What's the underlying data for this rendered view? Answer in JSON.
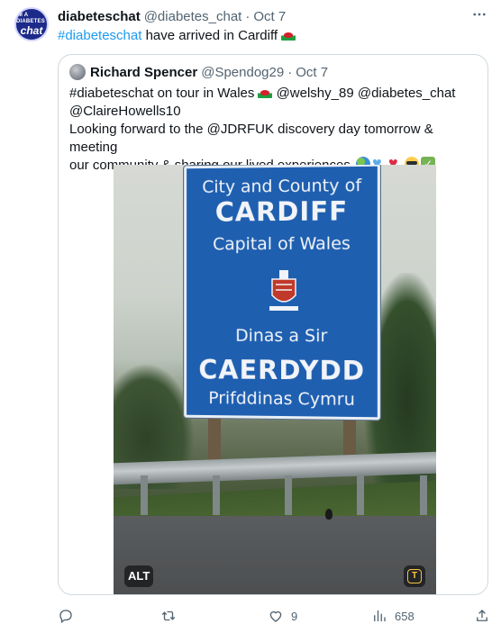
{
  "tweet": {
    "author_name": "diabeteschat",
    "author_handle": "@diabetes_chat",
    "separator": "·",
    "time": "Oct 7",
    "avatar_text_small": "IM A DIABETES",
    "avatar_text_big": "chat",
    "hashtag": "#diabeteschat",
    "text_rest": " have arrived in Cardiff",
    "flag_icon": "wales-flag-icon"
  },
  "quote": {
    "author_name": "Richard Spencer",
    "author_handle": "@Spendog29",
    "separator": "·",
    "time": "Oct 7",
    "line1_a": "#diabeteschat on tour in Wales",
    "line1_b": " @welshy_89 @diabetes_chat",
    "line2": "@ClaireHowells10",
    "line3": "Looking forward to the @JDRFUK discovery day tomorrow & meeting",
    "line4": "our community & sharing our lived experiences",
    "emoji_icons": [
      "globe-icon",
      "blue-heart-icon",
      "red-heart-icon",
      "sunglasses-face-icon",
      "check-mark-icon"
    ]
  },
  "photo": {
    "sign_line1": "City and County of",
    "sign_line2": "CARDIFF",
    "sign_line3": "Capital of Wales",
    "sign_line4": "Dinas a Sir",
    "sign_line5": "CAERDYDD",
    "sign_line6": "Prifddinas Cymru",
    "alt_badge": "ALT",
    "t_badge": "T"
  },
  "actions": {
    "reply_count": "",
    "retweet_count": "",
    "like_count": "9",
    "views_count": "658"
  },
  "colors": {
    "link": "#1d9bf0",
    "secondary_text": "#536471",
    "border": "#cfd9de",
    "sign_blue": "#1f5fb0"
  }
}
